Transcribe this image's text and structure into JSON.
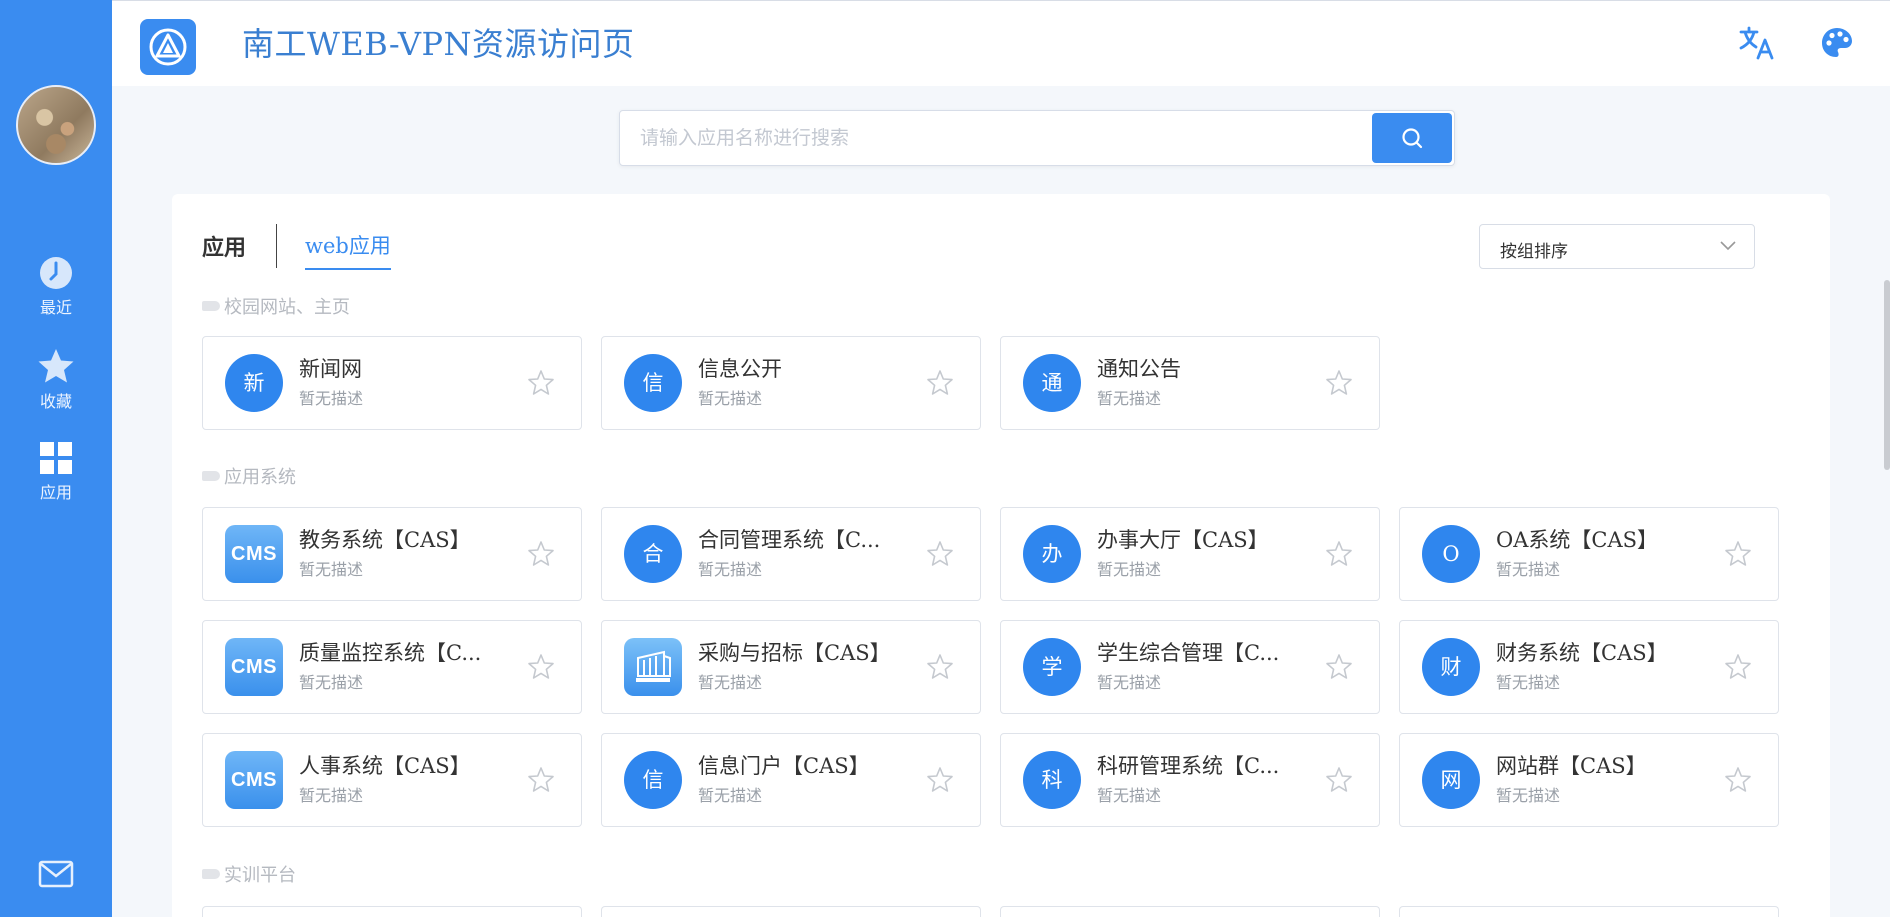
{
  "header": {
    "title": "南工WEB-VPN资源访问页",
    "logo_icon": "vpn-logo-icon",
    "translate_icon": "translate-icon",
    "palette_icon": "palette-icon"
  },
  "sidebar": {
    "items": [
      {
        "label": "最近",
        "icon": "clock-icon"
      },
      {
        "label": "收藏",
        "icon": "star-icon"
      },
      {
        "label": "应用",
        "icon": "grid-icon"
      }
    ],
    "mail_icon": "mail-icon"
  },
  "search": {
    "placeholder": "请输入应用名称进行搜索",
    "value": ""
  },
  "tabs": {
    "main": "应用",
    "web": "web应用"
  },
  "sort": {
    "selected": "按组排序"
  },
  "groups": [
    {
      "title": "校园网站、主页",
      "apps": [
        {
          "icon_text": "新",
          "name": "新闻网",
          "desc": "暂无描述"
        },
        {
          "icon_text": "信",
          "name": "信息公开",
          "desc": "暂无描述"
        },
        {
          "icon_text": "通",
          "name": "通知公告",
          "desc": "暂无描述"
        }
      ]
    },
    {
      "title": "应用系统",
      "apps": [
        {
          "icon_text": "CMS",
          "name": "教务系统【CAS】",
          "desc": "暂无描述"
        },
        {
          "icon_text": "合",
          "name": "合同管理系统【C...",
          "desc": "暂无描述"
        },
        {
          "icon_text": "办",
          "name": "办事大厅【CAS】",
          "desc": "暂无描述"
        },
        {
          "icon_text": "O",
          "name": "OA系统【CAS】",
          "desc": "暂无描述"
        },
        {
          "icon_text": "CMS",
          "name": "质量监控系统【C...",
          "desc": "暂无描述"
        },
        {
          "icon_text": "",
          "name": "采购与招标【CAS】",
          "desc": "暂无描述"
        },
        {
          "icon_text": "学",
          "name": "学生综合管理【C...",
          "desc": "暂无描述"
        },
        {
          "icon_text": "财",
          "name": "财务系统【CAS】",
          "desc": "暂无描述"
        },
        {
          "icon_text": "CMS",
          "name": "人事系统【CAS】",
          "desc": "暂无描述"
        },
        {
          "icon_text": "信",
          "name": "信息门户【CAS】",
          "desc": "暂无描述"
        },
        {
          "icon_text": "科",
          "name": "科研管理系统【C...",
          "desc": "暂无描述"
        },
        {
          "icon_text": "网",
          "name": "网站群【CAS】",
          "desc": "暂无描述"
        }
      ]
    },
    {
      "title": "实训平台",
      "apps": []
    }
  ],
  "colors": {
    "primary": "#3a8cf0",
    "title": "#3a7fd1",
    "muted": "#9aa0a8"
  }
}
